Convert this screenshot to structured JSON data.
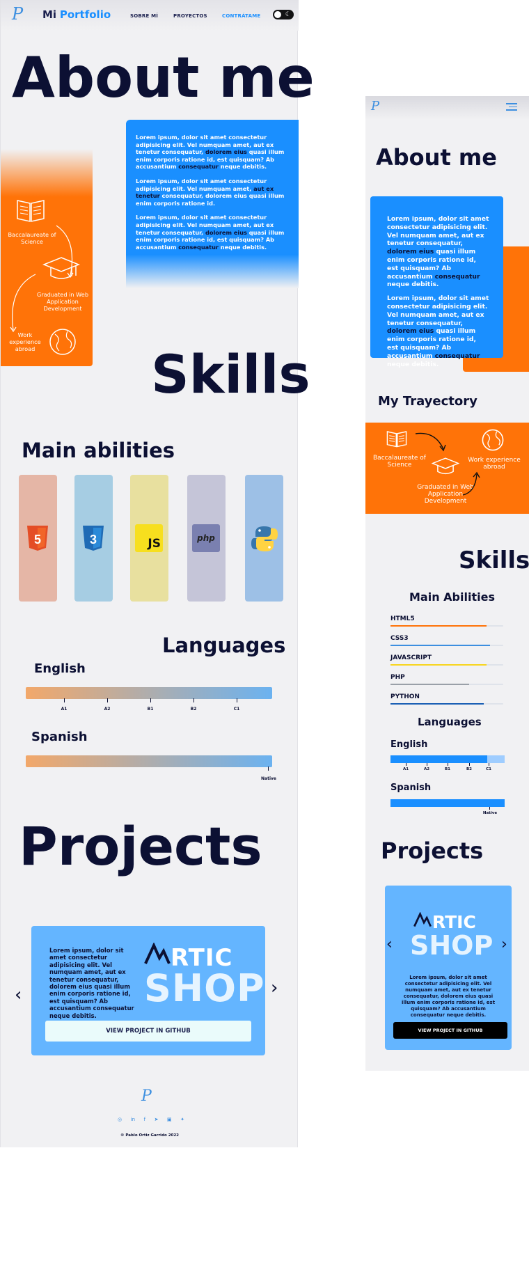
{
  "desktop": {
    "brand": {
      "first": "Mi",
      "second": "Portfolio",
      "logo": "P"
    },
    "nav": [
      {
        "label": "SOBRE MÍ"
      },
      {
        "label": "PROYECTOS"
      },
      {
        "label": "CONTRÁTAME",
        "active": true
      }
    ],
    "theme_toggle_icon": "moon-icon",
    "about": {
      "title": "About me",
      "paragraphs": [
        {
          "a": "Lorem ipsum, dolor sit amet consectetur adipisicing elit. Vel numquam amet, aut ex tenetur consequatur, ",
          "hl1": "dolorem eius",
          "b": " quasi illum enim corporis ratione id, est quisquam? Ab accusantium ",
          "hl2": "consequatur",
          "c": " neque debitis."
        },
        {
          "a": "Lorem ipsum, dolor sit amet consectetur adipisicing elit. Vel numquam amet, ",
          "hl1": "aut ex tenetur",
          "b": " consequatur, dolorem eius quasi illum enim corporis ratione id.",
          "hl2": "",
          "c": ""
        },
        {
          "a": "Lorem ipsum, dolor sit amet consectetur adipisicing elit. Vel numquam amet, aut ex tenetur consequatur, ",
          "hl1": "dolorem eius",
          "b": " quasi illum enim corporis ratione id, est quisquam? Ab accusantium ",
          "hl2": "consequatur",
          "c": " neque debitis."
        }
      ],
      "trajectory": [
        {
          "label": "Baccalaureate of Science",
          "icon": "book-icon"
        },
        {
          "label": "Graduated in Web Application Development",
          "icon": "graduation-cap-icon"
        },
        {
          "label": "Work experience abroad",
          "icon": "globe-icon"
        }
      ]
    },
    "skills": {
      "title": "Skills",
      "main_title": "Main abilities",
      "cards": [
        {
          "name": "html5",
          "icon": "html5-icon",
          "label": "5",
          "bg": "#e5b6a6",
          "badge": "#e44d26"
        },
        {
          "name": "css3",
          "icon": "css3-icon",
          "label": "3",
          "bg": "#a6cde3",
          "badge": "#1f6bb5"
        },
        {
          "name": "javascript",
          "icon": "javascript-icon",
          "label": "JS",
          "bg": "#e8e09f",
          "badge": "#f7df1e"
        },
        {
          "name": "php",
          "icon": "php-icon",
          "label": "php",
          "bg": "#c5c5d8",
          "badge": "#7a80b0"
        },
        {
          "name": "python",
          "icon": "python-icon",
          "label": "",
          "bg": "#9dc0e6",
          "badge": "#3776ab"
        }
      ],
      "languages_title": "Languages",
      "languages": [
        {
          "name": "English",
          "ticks": [
            "A1",
            "A2",
            "B1",
            "B2",
            "C1"
          ]
        },
        {
          "name": "Spanish",
          "ticks": [
            "Native"
          ]
        }
      ]
    },
    "projects": {
      "title": "Projects",
      "description": "Lorem ipsum, dolor sit amet consectetur adipisicing elit. Vel numquam amet, aut ex tenetur consequatur, dolorem eius quasi illum enim corporis ratione id, est quisquam? Ab accusantium consequatur neque debitis.",
      "logo_top": "RTIC",
      "logo_bottom": "SHOP",
      "button": "VIEW PROJECT IN GITHUB"
    },
    "footer": {
      "icons": [
        "whatsapp-icon",
        "linkedin-icon",
        "facebook-icon",
        "telegram-icon",
        "instagram-icon",
        "twitter-icon"
      ],
      "copyright": "© Pablo Ortiz Garrido 2022"
    }
  },
  "mobile": {
    "logo": "P",
    "menu_icon": "hamburger-menu-icon",
    "about": {
      "title": "About me",
      "paragraphs": [
        {
          "a": "Lorem ipsum, dolor sit amet consectetur adipisicing elit. Vel numquam amet, aut ex tenetur consequatur, ",
          "hl1": "dolorem eius",
          "b": " quasi illum enim corporis ratione id, est quisquam? Ab accusantium ",
          "hl2": "consequatur",
          "c": " neque debitis."
        },
        {
          "a": "Lorem ipsum, dolor sit amet consectetur adipisicing elit. Vel numquam amet, aut ex tenetur consequatur, ",
          "hl1": "dolorem eius",
          "b": " quasi illum enim corporis ratione id, est quisquam? Ab accusantium ",
          "hl2": "consequatur",
          "c": " neque debitis."
        }
      ]
    },
    "trajectory": {
      "title": "My Trayectory",
      "items": [
        {
          "label": "Baccalaureate of Science",
          "icon": "book-icon"
        },
        {
          "label": "Work experience abroad",
          "icon": "globe-icon"
        },
        {
          "label": "Graduated in Web Application Development",
          "icon": "graduation-cap-icon"
        }
      ]
    },
    "skills": {
      "title": "Skills",
      "main_title": "Main Abilities",
      "bars": [
        {
          "label": "HTML5",
          "level": 0.85,
          "color": "#ff7308"
        },
        {
          "label": "CSS3",
          "level": 0.88,
          "color": "#3d8fe0"
        },
        {
          "label": "JAVASCRIPT",
          "level": 0.85,
          "color": "#f7d51e"
        },
        {
          "label": "PHP",
          "level": 0.7,
          "color": "#9aa0a8"
        },
        {
          "label": "PYTHON",
          "level": 0.83,
          "color": "#1a5fb4"
        }
      ],
      "languages_title": "Languages",
      "languages": [
        {
          "name": "English",
          "level": 0.85,
          "ticks": [
            "A1",
            "A2",
            "B1",
            "B2",
            "C1"
          ]
        },
        {
          "name": "Spanish",
          "level": 1.0,
          "ticks": [
            "Native"
          ]
        }
      ]
    },
    "projects": {
      "title": "Projects",
      "logo_top": "RTIC",
      "logo_bottom": "SHOP",
      "description": "Lorem ipsum, dolor sit amet consectetur adipisicing elit. Vel numquam amet, aut ex tenetur consequatur, dolorem eius quasi illum enim corporis ratione id, est quisquam? Ab accusantium consequatur neque debitis.",
      "button": "VIEW PROJECT IN GITHUB"
    }
  }
}
